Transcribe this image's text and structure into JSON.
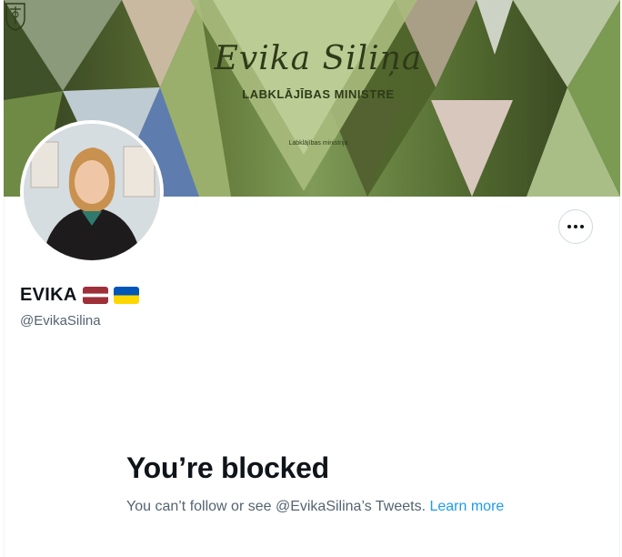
{
  "banner": {
    "name": "Evika Siliņa",
    "title": "LABKLĀJĪBAS MINISTRE",
    "ministry": "Labklājības ministrija"
  },
  "profile": {
    "display_name": "EVIKA",
    "handle": "@EvikaSilina",
    "flags": [
      "latvia-flag-icon",
      "ukraine-flag-icon"
    ]
  },
  "actions": {
    "more_icon": "more-horizontal-icon"
  },
  "blocked": {
    "title": "You’re blocked",
    "message": "You can’t follow or see @EvikaSilina’s Tweets.",
    "link": "Learn more"
  },
  "colors": {
    "link": "#1d9bf0",
    "secondary_text": "#536471",
    "primary_text": "#0f1419",
    "latvia_red": "#9e3039",
    "ukraine_blue": "#0057b7",
    "ukraine_yellow": "#ffd700"
  }
}
